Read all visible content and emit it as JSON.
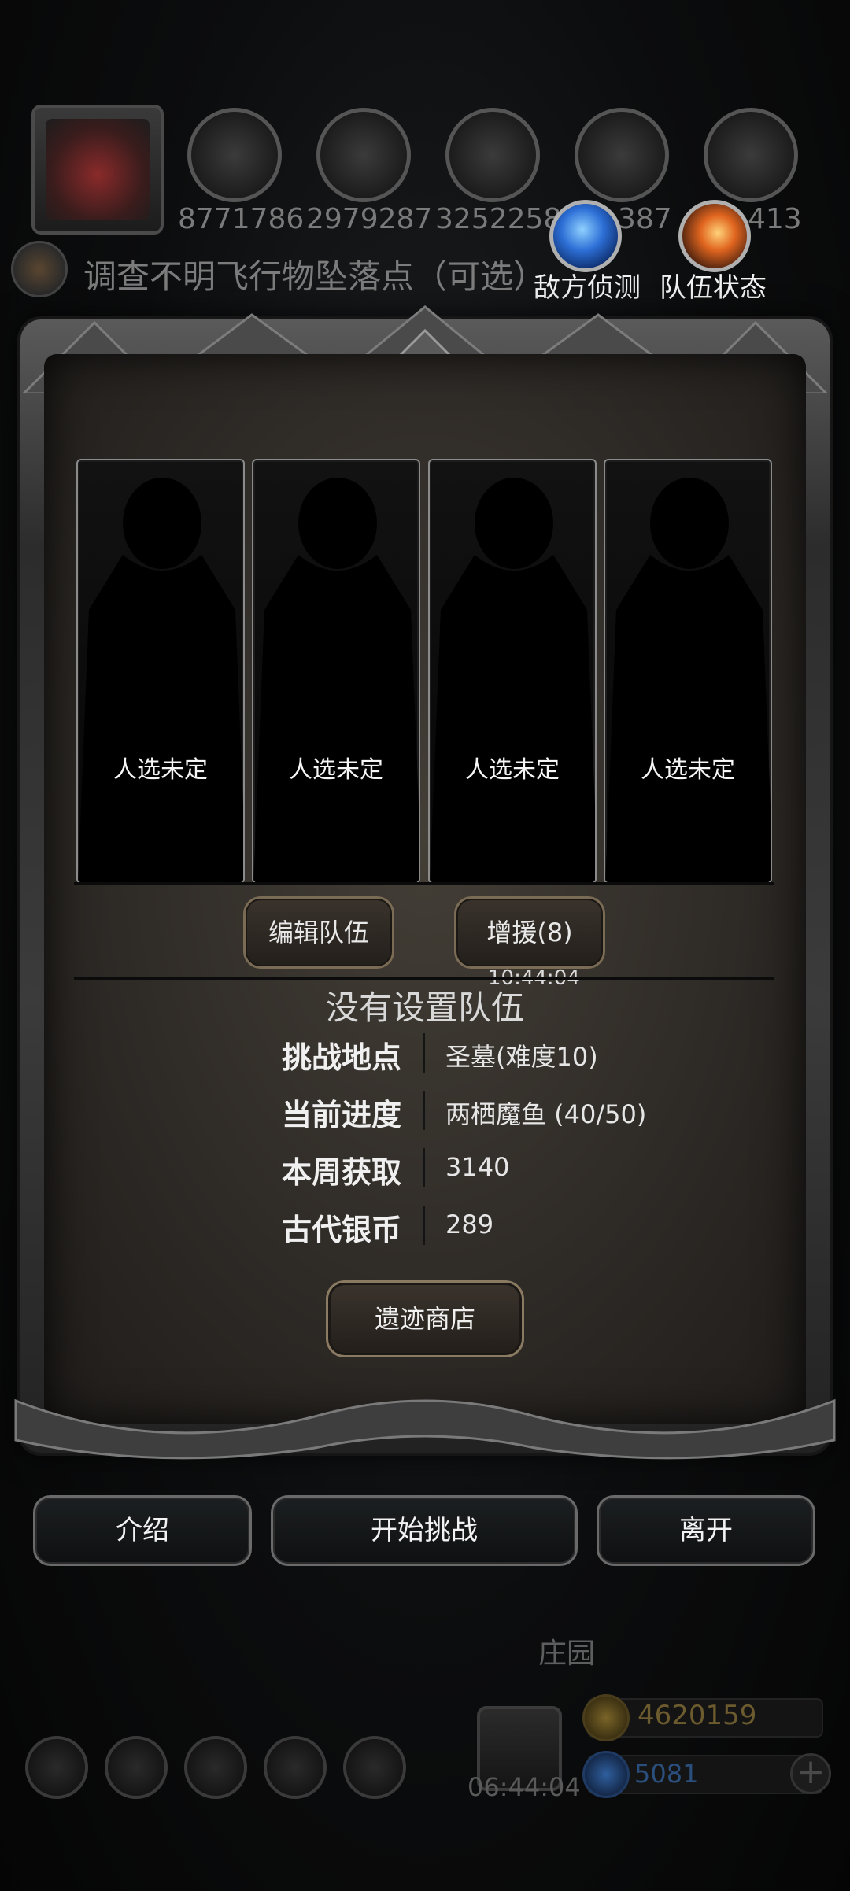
{
  "resources": {
    "values": [
      "8771786",
      "2979287",
      "3252258",
      "387",
      "413"
    ]
  },
  "quest": {
    "text": "调查不明飞行物坠落点（可选）"
  },
  "top_buttons": {
    "enemy_scout": "敌方侦测",
    "team_status": "队伍状态"
  },
  "team_slots": [
    {
      "label": "人选未定"
    },
    {
      "label": "人选未定"
    },
    {
      "label": "人选未定"
    },
    {
      "label": "人选未定"
    }
  ],
  "actions": {
    "edit_team": "编辑队伍",
    "reinforce": "增援(8)",
    "timer": "10:44:04"
  },
  "status": {
    "no_team": "没有设置队伍"
  },
  "info": [
    {
      "key": "挑战地点",
      "value": "圣墓(难度10)"
    },
    {
      "key": "当前进度",
      "value": "两栖魔鱼 (40/50)"
    },
    {
      "key": "本周获取",
      "value": "3140"
    },
    {
      "key": "古代银币",
      "value": "289"
    }
  ],
  "shop_button": "遗迹商店",
  "bottom_buttons": {
    "intro": "介绍",
    "start": "开始挑战",
    "leave": "离开"
  },
  "hud": {
    "estate": "庄园",
    "timer": "06:44:04",
    "gold": "4620159",
    "gems": "5081",
    "plus": "+"
  },
  "colors": {
    "gold": "#c9a13a",
    "gem_blue": "#3b7fd6",
    "frame_silver": "#8b8b8b"
  }
}
